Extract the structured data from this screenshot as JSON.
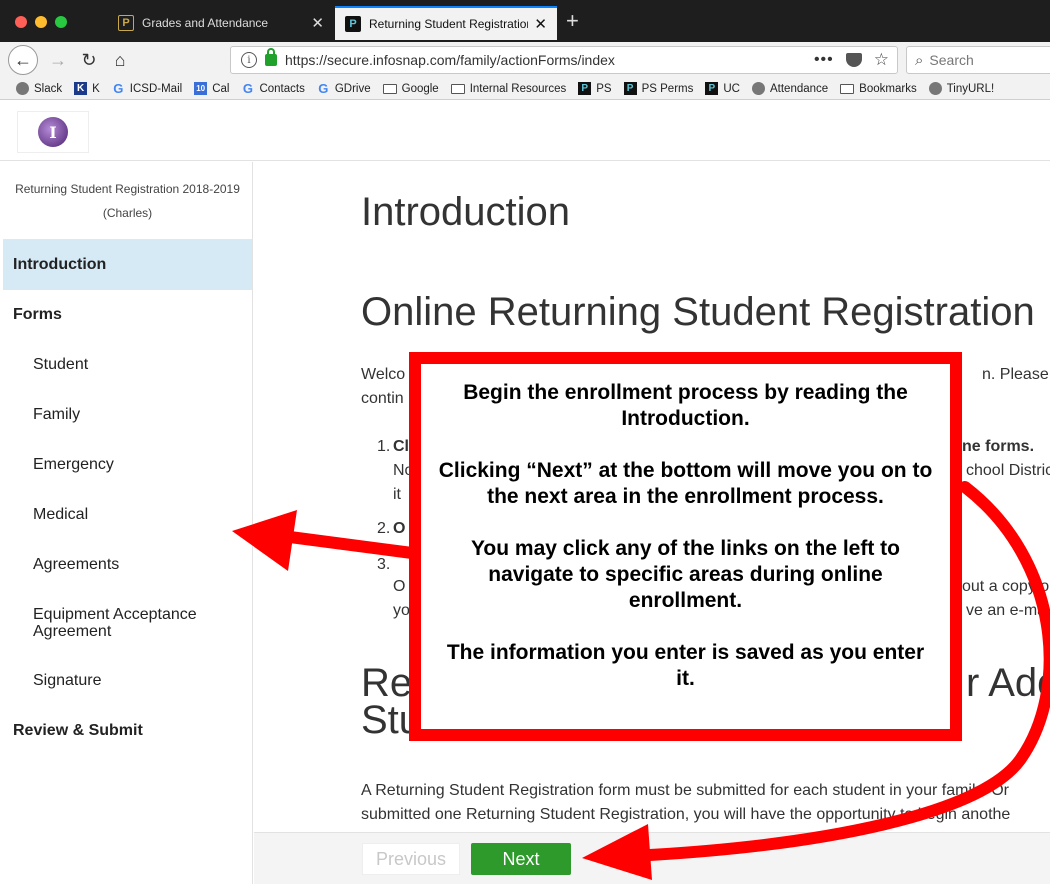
{
  "browser": {
    "tabs": [
      {
        "title": "Grades and Attendance",
        "active": false
      },
      {
        "title": "Returning Student Registration",
        "active": true
      }
    ],
    "new_tab_icon": "plus-icon",
    "url": "https://secure.infosnap.com/family/actionForms/index",
    "more_label": "•••",
    "search_placeholder": "Search",
    "bookmarks": [
      {
        "label": "Slack",
        "icon": "globe-icon"
      },
      {
        "label": "K",
        "icon": "k-icon"
      },
      {
        "label": "ICSD-Mail",
        "icon": "google-icon"
      },
      {
        "label": "Cal",
        "icon": "calendar-icon"
      },
      {
        "label": "Contacts",
        "icon": "google-icon"
      },
      {
        "label": "GDrive",
        "icon": "google-icon"
      },
      {
        "label": "Google",
        "icon": "folder-icon"
      },
      {
        "label": "Internal Resources",
        "icon": "folder-icon"
      },
      {
        "label": "PS",
        "icon": "powerschool-icon"
      },
      {
        "label": "PS Perms",
        "icon": "powerschool-icon"
      },
      {
        "label": "UC",
        "icon": "powerschool-icon"
      },
      {
        "label": "Attendance",
        "icon": "globe-icon"
      },
      {
        "label": "Bookmarks",
        "icon": "folder-icon"
      },
      {
        "label": "TinyURL!",
        "icon": "globe-icon"
      }
    ]
  },
  "sidebar": {
    "title_line1": "Returning Student Registration 2018-2019",
    "title_line2": "(Charles)",
    "items": [
      {
        "label": "Introduction",
        "kind": "active"
      },
      {
        "label": "Forms",
        "kind": "section"
      },
      {
        "label": "Student",
        "kind": "sub"
      },
      {
        "label": "Family",
        "kind": "sub"
      },
      {
        "label": "Emergency",
        "kind": "sub"
      },
      {
        "label": "Medical",
        "kind": "sub"
      },
      {
        "label": "Agreements",
        "kind": "sub"
      },
      {
        "label": "Equipment Acceptance Agreement",
        "kind": "sub"
      },
      {
        "label": "Signature",
        "kind": "sub"
      },
      {
        "label": "Review & Submit",
        "kind": "section"
      }
    ]
  },
  "main": {
    "heading": "Introduction",
    "subheading": "Online Returning Student Registration",
    "welcome_start": "Welco",
    "welcome_end": "n.  Please fo",
    "contin": "contin",
    "list_1_num": "1.",
    "list_1_start": "Cl",
    "list_1_end": "ne forms.",
    "list_1b_start": "No",
    "list_1b_end": "chool Distric",
    "list_1c": "it",
    "list_2_num": "2.",
    "list_2_start": "O",
    "list_3_num": "3.",
    "list_3_start": "O",
    "list_3_end": "out a copy o",
    "list_3b_start": "yo",
    "list_3b_end": "ve an e-mai",
    "section3_start": "Re",
    "section3_end": "r Ado",
    "section3_line2": "Students",
    "para2_line1": "A Returning Student Registration form must be submitted for each student in your family. Or",
    "para2_line2": "submitted one Returning Student Registration, you will have the opportunity to begin anothe",
    "previous_label": "Previous",
    "next_label": "Next"
  },
  "callout": {
    "line1": "Begin the enrollment process by reading the Introduction.",
    "line2": "Clicking “Next” at the bottom will move you on to the next area in the enrollment process.",
    "line3": "You may click any of the links on the left to navigate to specific areas during online enrollment.",
    "line4": "The information you enter is saved as you enter it."
  },
  "colors": {
    "accent_red": "#ff0000",
    "next_green": "#2e9a2b",
    "sidebar_active": "#d6eaf5"
  }
}
